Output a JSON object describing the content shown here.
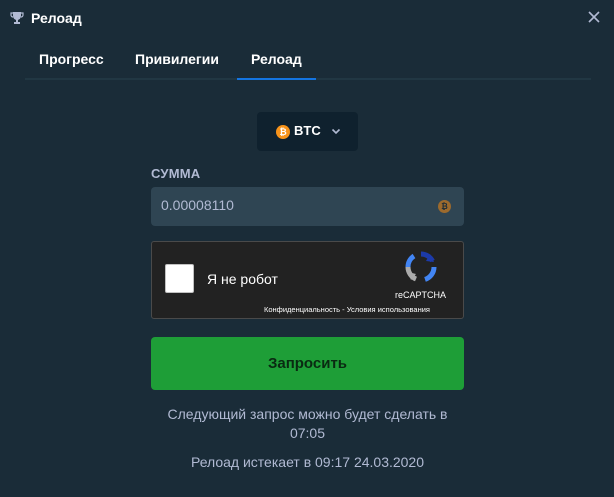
{
  "window": {
    "title": "Релоад",
    "icon": "trophy-icon"
  },
  "tabs": [
    {
      "label": "Прогресс",
      "active": false
    },
    {
      "label": "Привилегии",
      "active": false
    },
    {
      "label": "Релоад",
      "active": true
    }
  ],
  "currency": {
    "selected": "BTC",
    "coin_symbol": "₿",
    "icon": "bitcoin-icon"
  },
  "amount": {
    "label": "СУММА",
    "value": "0.00008110",
    "coin_symbol": "₿"
  },
  "captcha": {
    "label": "Я не робот",
    "brand": "reCAPTCHA",
    "links": "Конфиденциальность - Условия использования"
  },
  "actions": {
    "request_label": "Запросить"
  },
  "info": {
    "next_request_line1": "Следующий запрос можно будет сделать в",
    "next_request_line2": "07:05",
    "expires": "Релоад истекает в 09:17 24.03.2020"
  },
  "colors": {
    "background": "#1a2c38",
    "tab_active_underline": "#1475e1",
    "button": "#1e9e37",
    "input_bg": "#2f4553",
    "bitcoin": "#f7931a"
  }
}
